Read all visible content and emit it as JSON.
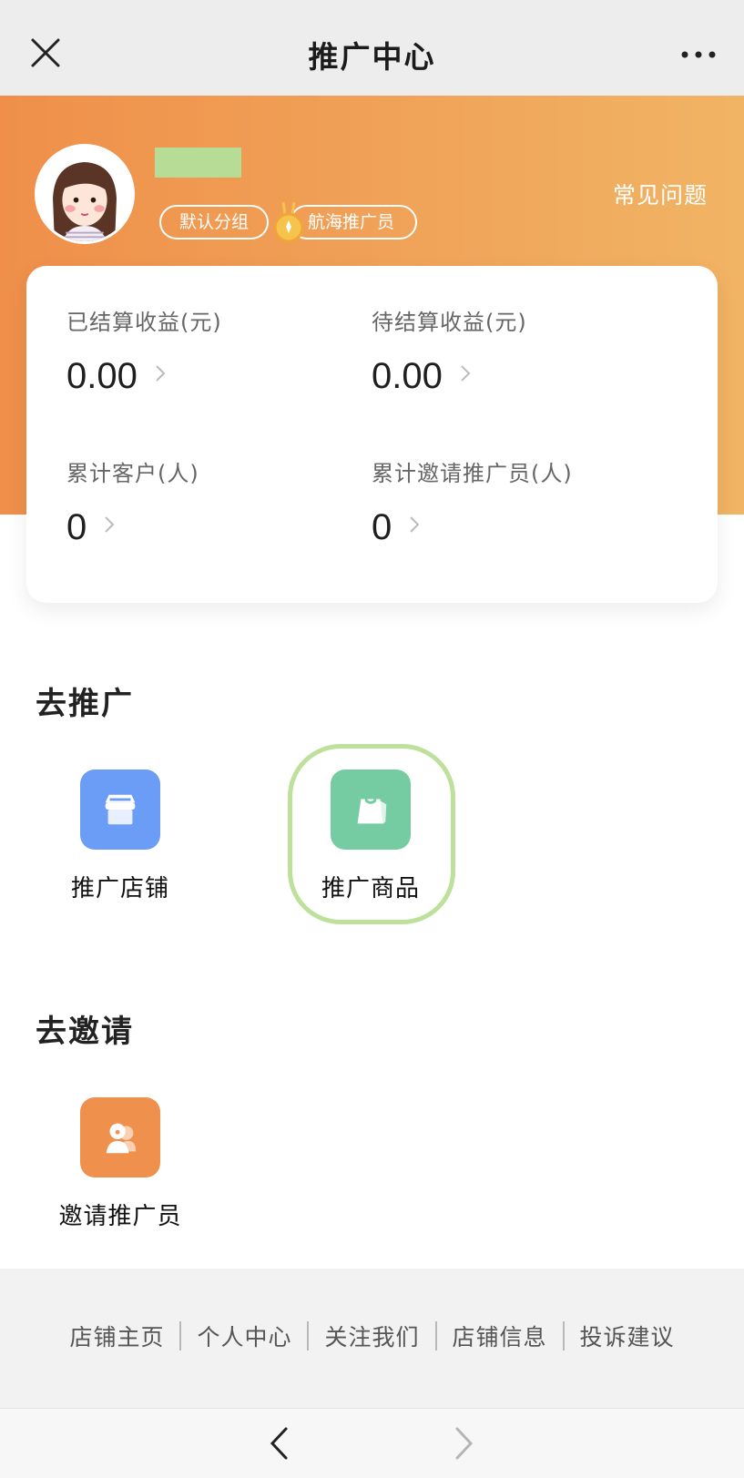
{
  "topbar": {
    "title": "推广中心",
    "close_icon": "close-icon",
    "more_icon": "more-dots-icon"
  },
  "profile": {
    "group_tag": "默认分组",
    "level_tag": "航海推广员",
    "faq_link": "常见问题",
    "avatar_icon": "avatar-cartoon-girl",
    "medal_icon": "medal-icon"
  },
  "stats": {
    "settled": {
      "label": "已结算收益(元)",
      "value": "0.00"
    },
    "pending": {
      "label": "待结算收益(元)",
      "value": "0.00"
    },
    "customers": {
      "label": "累计客户(人)",
      "value": "0"
    },
    "invited": {
      "label": "累计邀请推广员(人)",
      "value": "0"
    }
  },
  "promote": {
    "title": "去推广",
    "items": [
      {
        "label": "推广店铺",
        "icon": "store-icon",
        "color": "#6b9cf6"
      },
      {
        "label": "推广商品",
        "icon": "shopping-bag-icon",
        "color": "#75cba2"
      }
    ]
  },
  "invite": {
    "title": "去邀请",
    "items": [
      {
        "label": "邀请推广员",
        "icon": "invite-person-icon",
        "color": "#f0904d"
      }
    ]
  },
  "footer": {
    "links": [
      "店铺主页",
      "个人中心",
      "关注我们",
      "店铺信息",
      "投诉建议"
    ]
  },
  "nav": {
    "back_icon": "chevron-left-icon",
    "forward_icon": "chevron-right-icon"
  },
  "colors": {
    "hero_start": "#ef8f4a",
    "hero_end": "#f1b464",
    "highlight": "#bde19b"
  }
}
